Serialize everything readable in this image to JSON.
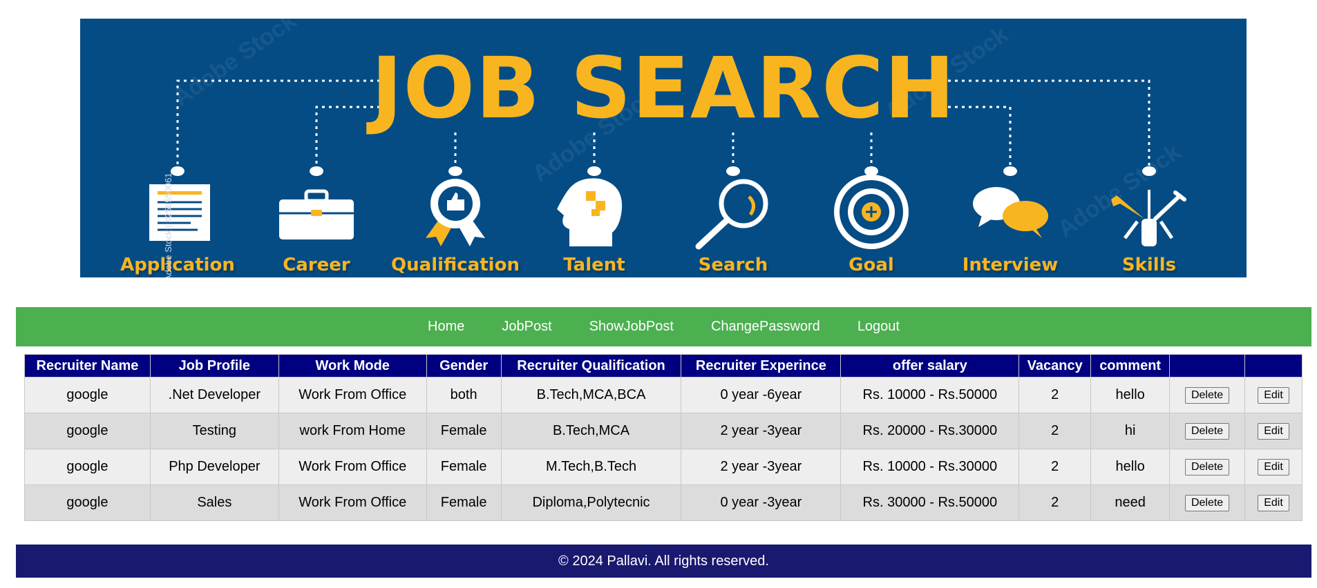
{
  "banner": {
    "title": "JOB SEARCH",
    "side_credit": "Adobe Stock | #258550061",
    "watermark": "Adobe Stock",
    "categories": [
      {
        "label": "Application",
        "icon": "application-form-icon"
      },
      {
        "label": "Career",
        "icon": "briefcase-icon"
      },
      {
        "label": "Qualification",
        "icon": "award-badge-icon"
      },
      {
        "label": "Talent",
        "icon": "head-puzzle-icon"
      },
      {
        "label": "Search",
        "icon": "magnifier-icon"
      },
      {
        "label": "Goal",
        "icon": "target-icon"
      },
      {
        "label": "Interview",
        "icon": "speech-bubbles-icon"
      },
      {
        "label": "Skills",
        "icon": "tools-icon"
      }
    ],
    "colors": {
      "background": "#054c84",
      "accent": "#f8b520"
    }
  },
  "nav": {
    "items": [
      "Home",
      "JobPost",
      "ShowJobPost",
      "ChangePassword",
      "Logout"
    ],
    "color": "#4caf50"
  },
  "table": {
    "headers": [
      "Recruiter Name",
      "Job Profile",
      "Work Mode",
      "Gender",
      "Recruiter Qualification",
      "Recruiter Experince",
      "offer salary",
      "Vacancy",
      "comment",
      "",
      ""
    ],
    "header_color": "#000080",
    "delete_label": "Delete",
    "edit_label": "Edit",
    "rows": [
      [
        "google",
        ".Net Developer",
        "Work From Office",
        "both",
        "B.Tech,MCA,BCA",
        "0 year -6year",
        "Rs. 10000 - Rs.50000",
        "2",
        "hello"
      ],
      [
        "google",
        "Testing",
        "work From Home",
        "Female",
        "B.Tech,MCA",
        "2 year -3year",
        "Rs. 20000 - Rs.30000",
        "2",
        "hi"
      ],
      [
        "google",
        "Php Developer",
        "Work From Office",
        "Female",
        "M.Tech,B.Tech",
        "2 year -3year",
        "Rs. 10000 - Rs.30000",
        "2",
        "hello"
      ],
      [
        "google",
        "Sales",
        "Work From Office",
        "Female",
        "Diploma,Polytecnic",
        "0 year -3year",
        "Rs. 30000 - Rs.50000",
        "2",
        "need"
      ]
    ]
  },
  "footer": {
    "text": "© 2024 Pallavi. All rights reserved.",
    "color": "#191970"
  }
}
